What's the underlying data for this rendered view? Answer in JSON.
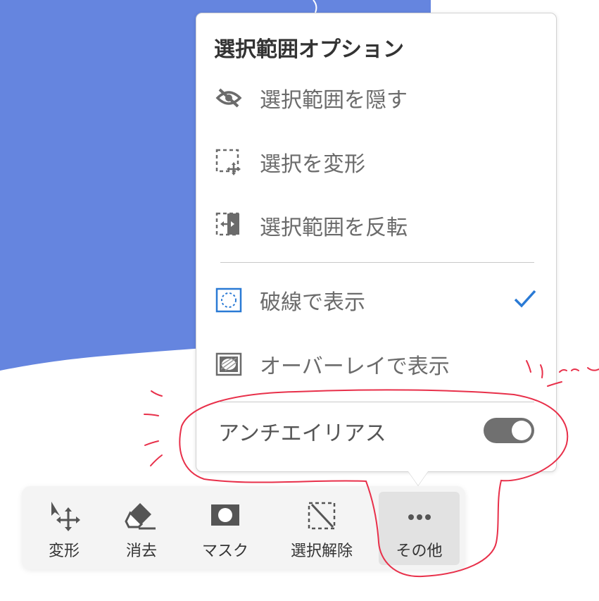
{
  "popover": {
    "title": "選択範囲オプション",
    "items": [
      {
        "label": "選択範囲を隠す",
        "icon": "eye-slash-icon"
      },
      {
        "label": "選択を変形",
        "icon": "transform-selection-icon"
      },
      {
        "label": "選択範囲を反転",
        "icon": "invert-selection-icon"
      },
      {
        "label": "破線で表示",
        "icon": "dashed-display-icon",
        "checked": true
      },
      {
        "label": "オーバーレイで表示",
        "icon": "overlay-display-icon",
        "checked": false
      }
    ],
    "antialias": {
      "label": "アンチエイリアス",
      "enabled": true
    }
  },
  "toolbar": {
    "items": [
      {
        "label": "変形",
        "icon": "move-arrow-icon"
      },
      {
        "label": "消去",
        "icon": "eraser-icon"
      },
      {
        "label": "マスク",
        "icon": "mask-icon"
      },
      {
        "label": "選択解除",
        "icon": "deselect-icon"
      },
      {
        "label": "その他",
        "icon": "more-icon",
        "active": true
      }
    ]
  },
  "colors": {
    "canvas_blue": "#6585df",
    "accent": "#2a7ad5",
    "annotation_red": "#e8304a",
    "toggle_on": "#707070"
  }
}
